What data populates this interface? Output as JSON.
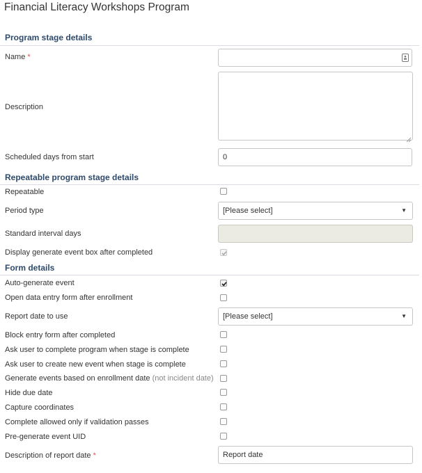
{
  "page": {
    "title": "Financial Literacy Workshops Program"
  },
  "sections": {
    "stage": "Program stage details",
    "repeatable": "Repeatable program stage details",
    "form": "Form details"
  },
  "fields": {
    "name": {
      "label": "Name",
      "required": "*",
      "value": ""
    },
    "description": {
      "label": "Description",
      "value": ""
    },
    "scheduled_days": {
      "label": "Scheduled days from start",
      "value": "0"
    },
    "repeatable": {
      "label": "Repeatable",
      "checked": false
    },
    "period_type": {
      "label": "Period type",
      "value": "[Please select]"
    },
    "standard_interval": {
      "label": "Standard interval days",
      "value": ""
    },
    "display_generate": {
      "label": "Display generate event box after completed",
      "checked": true,
      "disabled": true
    },
    "auto_generate": {
      "label": "Auto-generate event",
      "checked": true
    },
    "open_data_entry": {
      "label": "Open data entry form after enrollment",
      "checked": false
    },
    "report_date_to_use": {
      "label": "Report date to use",
      "value": "[Please select]"
    },
    "block_entry": {
      "label": "Block entry form after completed",
      "checked": false
    },
    "ask_complete": {
      "label": "Ask user to complete program when stage is complete",
      "checked": false
    },
    "ask_new_event": {
      "label": "Ask user to create new event when stage is complete",
      "checked": false
    },
    "generate_enrollment": {
      "label": "Generate events based on enrollment date",
      "note": "(not incident date)",
      "checked": false
    },
    "hide_due": {
      "label": "Hide due date",
      "checked": false
    },
    "capture_coords": {
      "label": "Capture coordinates",
      "checked": false
    },
    "complete_validation": {
      "label": "Complete allowed only if validation passes",
      "checked": false
    },
    "pregenerate_uid": {
      "label": "Pre-generate event UID",
      "checked": false
    },
    "report_date_desc": {
      "label": "Description of report date",
      "required": "*",
      "value": "Report date"
    }
  },
  "icons": {
    "name_field": "id-card-icon",
    "select": "caret-down-icon",
    "checkbox_check": "checkmark-icon",
    "resize": "resize-grip-icon"
  },
  "colors": {
    "section_heading": "#2f4a6b",
    "required": "#d9534f",
    "disabled_field": "#ebebe4",
    "rule": "#d9dde3"
  }
}
